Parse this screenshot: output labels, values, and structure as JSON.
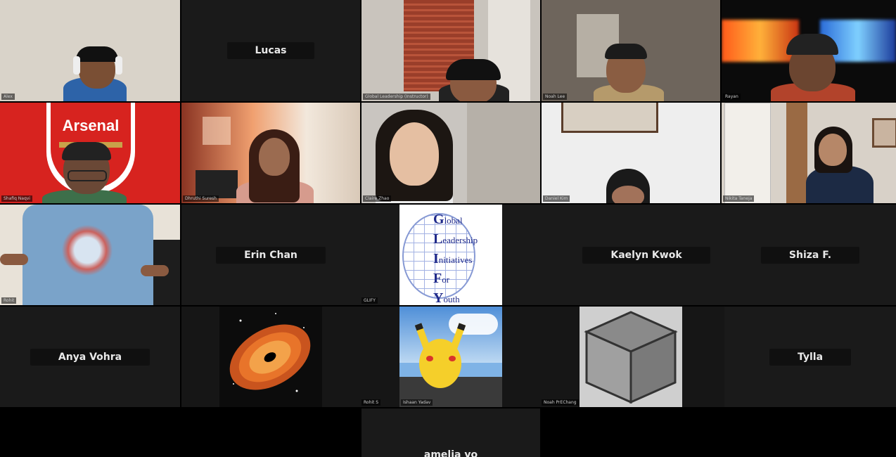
{
  "participants": [
    {
      "id": "p1",
      "name_tag": "Alex",
      "type": "video"
    },
    {
      "id": "p2",
      "display_name": "Lucas",
      "type": "name"
    },
    {
      "id": "p3",
      "name_tag": "Global Leadership (Instructor)",
      "type": "video"
    },
    {
      "id": "p4",
      "name_tag": "Noah Lee",
      "type": "video"
    },
    {
      "id": "p5",
      "name_tag": "Rayan",
      "type": "video"
    },
    {
      "id": "p6",
      "name_tag": "Shafiq Naqvi",
      "type": "video",
      "banner_text": "Arsenal"
    },
    {
      "id": "p7",
      "name_tag": "Dhruthi Suresh",
      "type": "video"
    },
    {
      "id": "p8",
      "name_tag": "Claire Zhao",
      "type": "video"
    },
    {
      "id": "p9",
      "name_tag": "Daniel Kim",
      "type": "video"
    },
    {
      "id": "p10",
      "name_tag": "Nikita Taneja",
      "type": "video"
    },
    {
      "id": "p11",
      "name_tag": "Rohit",
      "type": "video"
    },
    {
      "id": "p12",
      "display_name": "Erin Chan",
      "type": "name",
      "name_tag": "GLIFY"
    },
    {
      "id": "p13",
      "type": "logo",
      "logo_lines": [
        {
          "initial": "G",
          "rest": "lobal"
        },
        {
          "initial": "L",
          "rest": "eadership"
        },
        {
          "initial": "I",
          "rest": "nitiatives"
        },
        {
          "initial": "F",
          "rest": "or"
        },
        {
          "initial": "Y",
          "rest": "outh"
        }
      ]
    },
    {
      "id": "p14",
      "display_name": "Kaelyn Kwok",
      "type": "name"
    },
    {
      "id": "p15",
      "display_name": "Shiza F.",
      "type": "name"
    },
    {
      "id": "p16",
      "display_name": "Anya Vohra",
      "type": "name"
    },
    {
      "id": "p17",
      "type": "image",
      "image": "black-hole-icon",
      "name_tag": "Rohit S"
    },
    {
      "id": "p18",
      "type": "image",
      "image": "pikachu-icon",
      "name_tag": "Ishaan Yadav"
    },
    {
      "id": "p19",
      "type": "image",
      "image": "cube-icon",
      "name_tag": "Noah PrEChang"
    },
    {
      "id": "p20",
      "display_name": "Tylla",
      "type": "name"
    },
    {
      "id": "p21",
      "display_name": "amelia vo",
      "type": "name"
    }
  ],
  "colors": {
    "tile_bg": "#1a1a1a",
    "arsenal_red": "#d7231f",
    "glify_blue": "#1f2a8a",
    "black_hole_orange": "#e8742a",
    "pikachu_yellow": "#f5cf2a",
    "cube_gray": "#8a8a8a"
  }
}
